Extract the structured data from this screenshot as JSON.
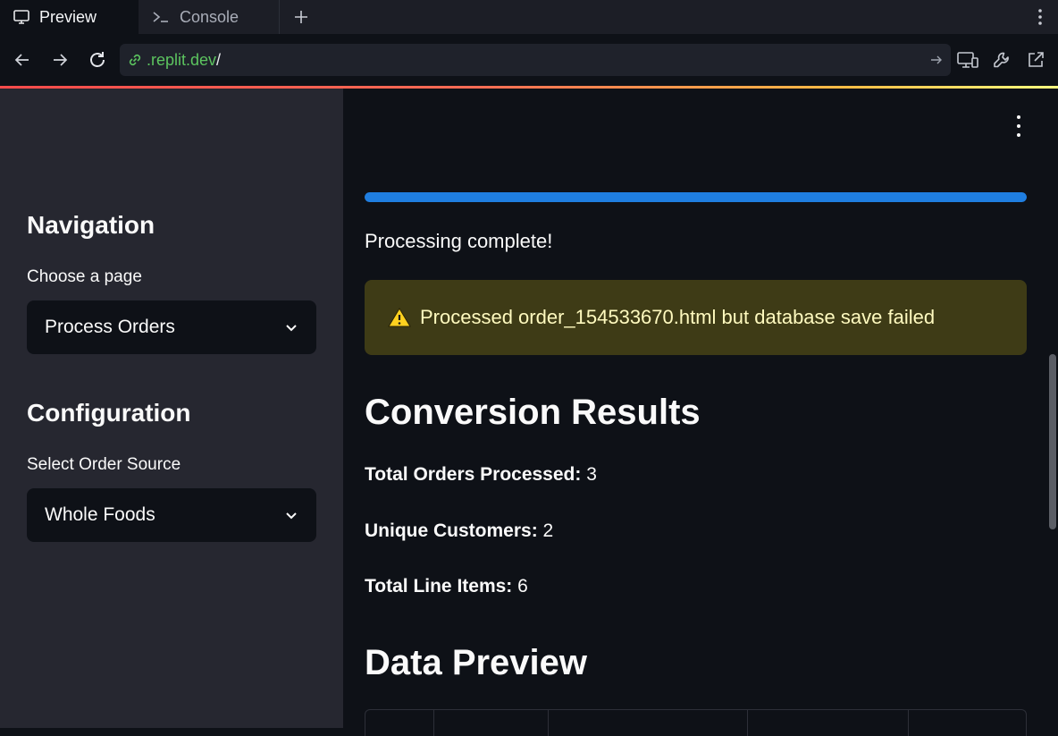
{
  "tabs": [
    {
      "label": "Preview",
      "icon": "monitor-icon",
      "active": true
    },
    {
      "label": "Console",
      "icon": "terminal-icon",
      "active": false
    }
  ],
  "address": {
    "host": ".replit.dev",
    "path": "/"
  },
  "sidebar": {
    "nav_heading": "Navigation",
    "page_label": "Choose a page",
    "page_value": "Process Orders",
    "config_heading": "Configuration",
    "source_label": "Select Order Source",
    "source_value": "Whole Foods"
  },
  "main": {
    "progress": 1.0,
    "status": "Processing complete!",
    "warning": "Processed order_154533670.html but database save failed",
    "results_heading": "Conversion Results",
    "stats": [
      {
        "label": "Total Orders Processed:",
        "value": "3"
      },
      {
        "label": "Unique Customers:",
        "value": "2"
      },
      {
        "label": "Total Line Items:",
        "value": "6"
      }
    ],
    "preview_heading": "Data Preview"
  },
  "colors": {
    "accent": "#1f7ee0",
    "warning_bg": "#3e3b16",
    "warning_text": "#fffabf",
    "url_green": "#5cc45f"
  }
}
